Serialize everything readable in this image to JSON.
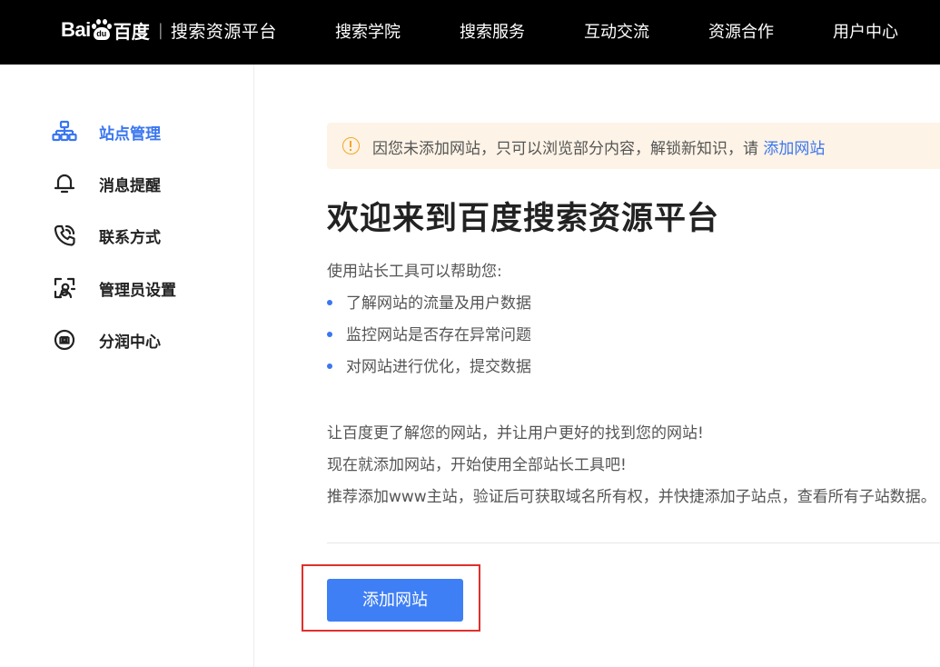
{
  "header": {
    "logo_latin": "Bai",
    "logo_paw_text": "du",
    "logo_cn": "百度",
    "logo_separator": "|",
    "platform_name": "搜索资源平台",
    "nav": [
      "搜索学院",
      "搜索服务",
      "互动交流",
      "资源合作",
      "用户中心"
    ]
  },
  "sidebar": {
    "items": [
      {
        "label": "站点管理",
        "icon": "sitemap-icon",
        "active": true
      },
      {
        "label": "消息提醒",
        "icon": "bell-icon",
        "active": false
      },
      {
        "label": "联系方式",
        "icon": "phone-icon",
        "active": false
      },
      {
        "label": "管理员设置",
        "icon": "admin-user-icon",
        "active": false
      },
      {
        "label": "分润中心",
        "icon": "revenue-share-icon",
        "active": false
      }
    ]
  },
  "notice": {
    "text": "因您未添加网站，只可以浏览部分内容，解锁新知识，请 ",
    "link": "添加网站",
    "icon": "warning-icon",
    "color": "#f5a623"
  },
  "main": {
    "title": "欢迎来到百度搜索资源平台",
    "intro": "使用站长工具可以帮助您:",
    "bullets": [
      "了解网站的流量及用户数据",
      "监控网站是否存在异常问题",
      "对网站进行优化，提交数据"
    ],
    "paragraphs": [
      "让百度更了解您的网站，并让用户更好的找到您的网站!",
      "现在就添加网站，开始使用全部站长工具吧!",
      "推荐添加www主站，验证后可获取域名所有权，并快捷添加子站点，查看所有子站数据。"
    ],
    "add_button": "添加网站"
  },
  "colors": {
    "accent": "#3a76f0",
    "button": "#3f7ff5",
    "notice_bg": "#fdf3e6",
    "highlight": "#e0302b"
  }
}
